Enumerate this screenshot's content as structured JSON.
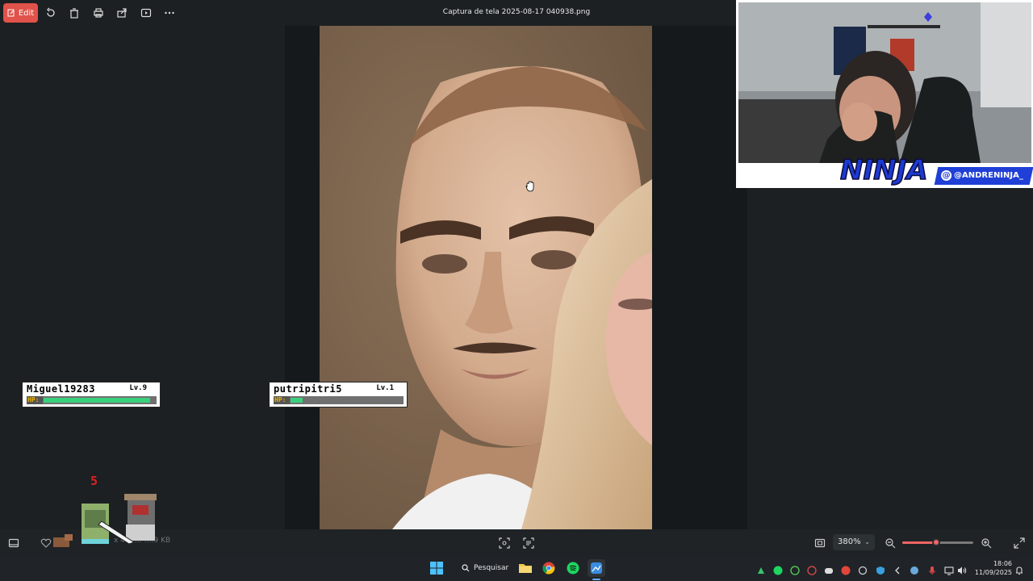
{
  "toolbar": {
    "edit_label": "Edit",
    "file_title": "Captura de tela 2025-08-17 040938.png"
  },
  "webcam": {
    "handle": "@ANDRENINJA_",
    "logo_text": "NINJA"
  },
  "players": [
    {
      "name": "Miguel19283",
      "level": "Lv.9",
      "hp_label": "HP:",
      "hp_fraction": 0.95
    },
    {
      "name": "putripitri5",
      "level": "Lv.1",
      "hp_label": "HP:",
      "hp_fraction": 0.11
    }
  ],
  "overlay": {
    "damage_number": "5"
  },
  "bottombar": {
    "file_info": "x 4… … ….9 KB",
    "zoom_level": "380%",
    "zoom_fraction": 0.48
  },
  "taskbar": {
    "search_label": "Pesquisar",
    "time": "18:06",
    "date": "11/09/2025"
  },
  "colors": {
    "edit_button": "#e0524a",
    "hp_fill": "#3ad17d",
    "zoom_accent": "#f06565",
    "handle_pill": "#1f3fd6"
  }
}
